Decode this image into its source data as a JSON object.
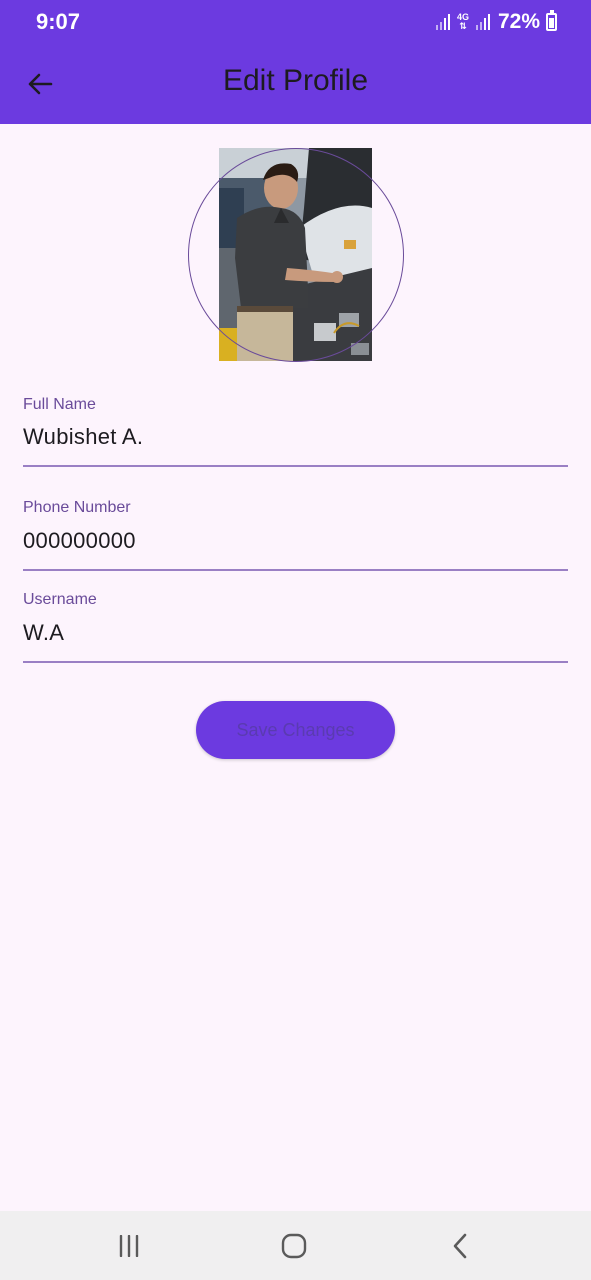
{
  "status_bar": {
    "time": "9:07",
    "network_type": "4G",
    "battery_percent": "72%"
  },
  "app_bar": {
    "title": "Edit Profile",
    "back_icon": "arrow-back-icon"
  },
  "avatar": {
    "description_icon": "profile-photo"
  },
  "form": {
    "full_name": {
      "label": "Full Name",
      "value": "Wubishet A."
    },
    "phone_number": {
      "label": "Phone Number",
      "value": "000000000"
    },
    "username": {
      "label": "Username",
      "value": "W.A"
    }
  },
  "save_button": {
    "label": "Save Changes"
  },
  "nav_bar": {
    "recent_icon": "recent-apps-icon",
    "home_icon": "home-icon",
    "back_icon": "nav-back-icon"
  },
  "colors": {
    "accent": "#6c3ae0",
    "background": "#fdf4fd",
    "label": "#6a4b9a",
    "underline": "#9a7fc4"
  }
}
